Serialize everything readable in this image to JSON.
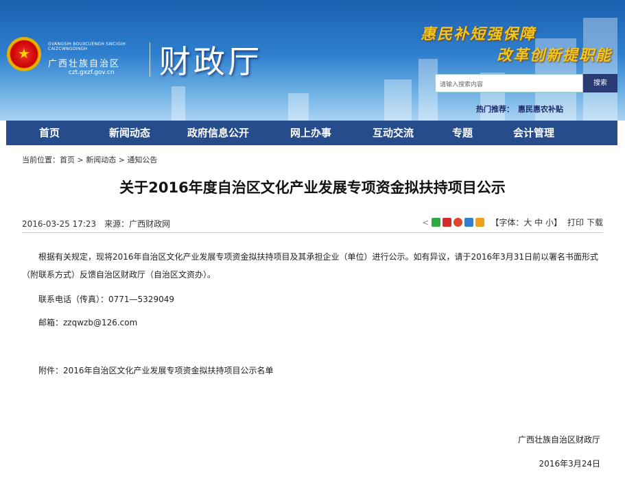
{
  "header": {
    "logo_latin": "GVANGSIH BOUXCUENGH SWCIGIH CAIZCWNGDINGH",
    "logo_cn": "广西壮族自治区",
    "logo_url": "czt.gxzf.gov.cn",
    "dept_name": "财政厅",
    "slogan1": "惠民补短强保障",
    "slogan2": "改革创新提职能",
    "search_placeholder": "请输入搜索内容",
    "search_button": "搜索",
    "hot_label": "热门推荐：",
    "hot_link": "惠民惠农补贴"
  },
  "nav": [
    "首页",
    "新闻动态",
    "政府信息公开",
    "网上办事",
    "互动交流",
    "专题",
    "会计管理"
  ],
  "breadcrumb": "当前位置：首页 > 新闻动态 > 通知公告",
  "article": {
    "title": "关于2016年度自治区文化产业发展专项资金拟扶持项目公示",
    "datetime": "2016-03-25 17:23",
    "source": "来源：广西财政网",
    "font_size_label": "【字体：大 中 小】",
    "print": "打印",
    "download": "下载",
    "p1": "根据有关规定，现将2016年自治区文化产业发展专项资金拟扶持项目及其承担企业（单位）进行公示。如有异议，请于2016年3月31日前以署名书面形式（附联系方式）反馈自治区财政厅（自治区文资办）。",
    "p2": "联系电话（传真）：0771—5329049",
    "p3": "邮箱：zzqwzb@126.com",
    "p4": "附件：2016年自治区文化产业发展专项资金拟扶持项目公示名单",
    "sign": "广西壮族自治区财政厅",
    "date": "2016年3月24日"
  },
  "colors": {
    "nav_bg": "#274c8b",
    "search_btn": "#2a3a75",
    "slogan": "#f5c518"
  }
}
